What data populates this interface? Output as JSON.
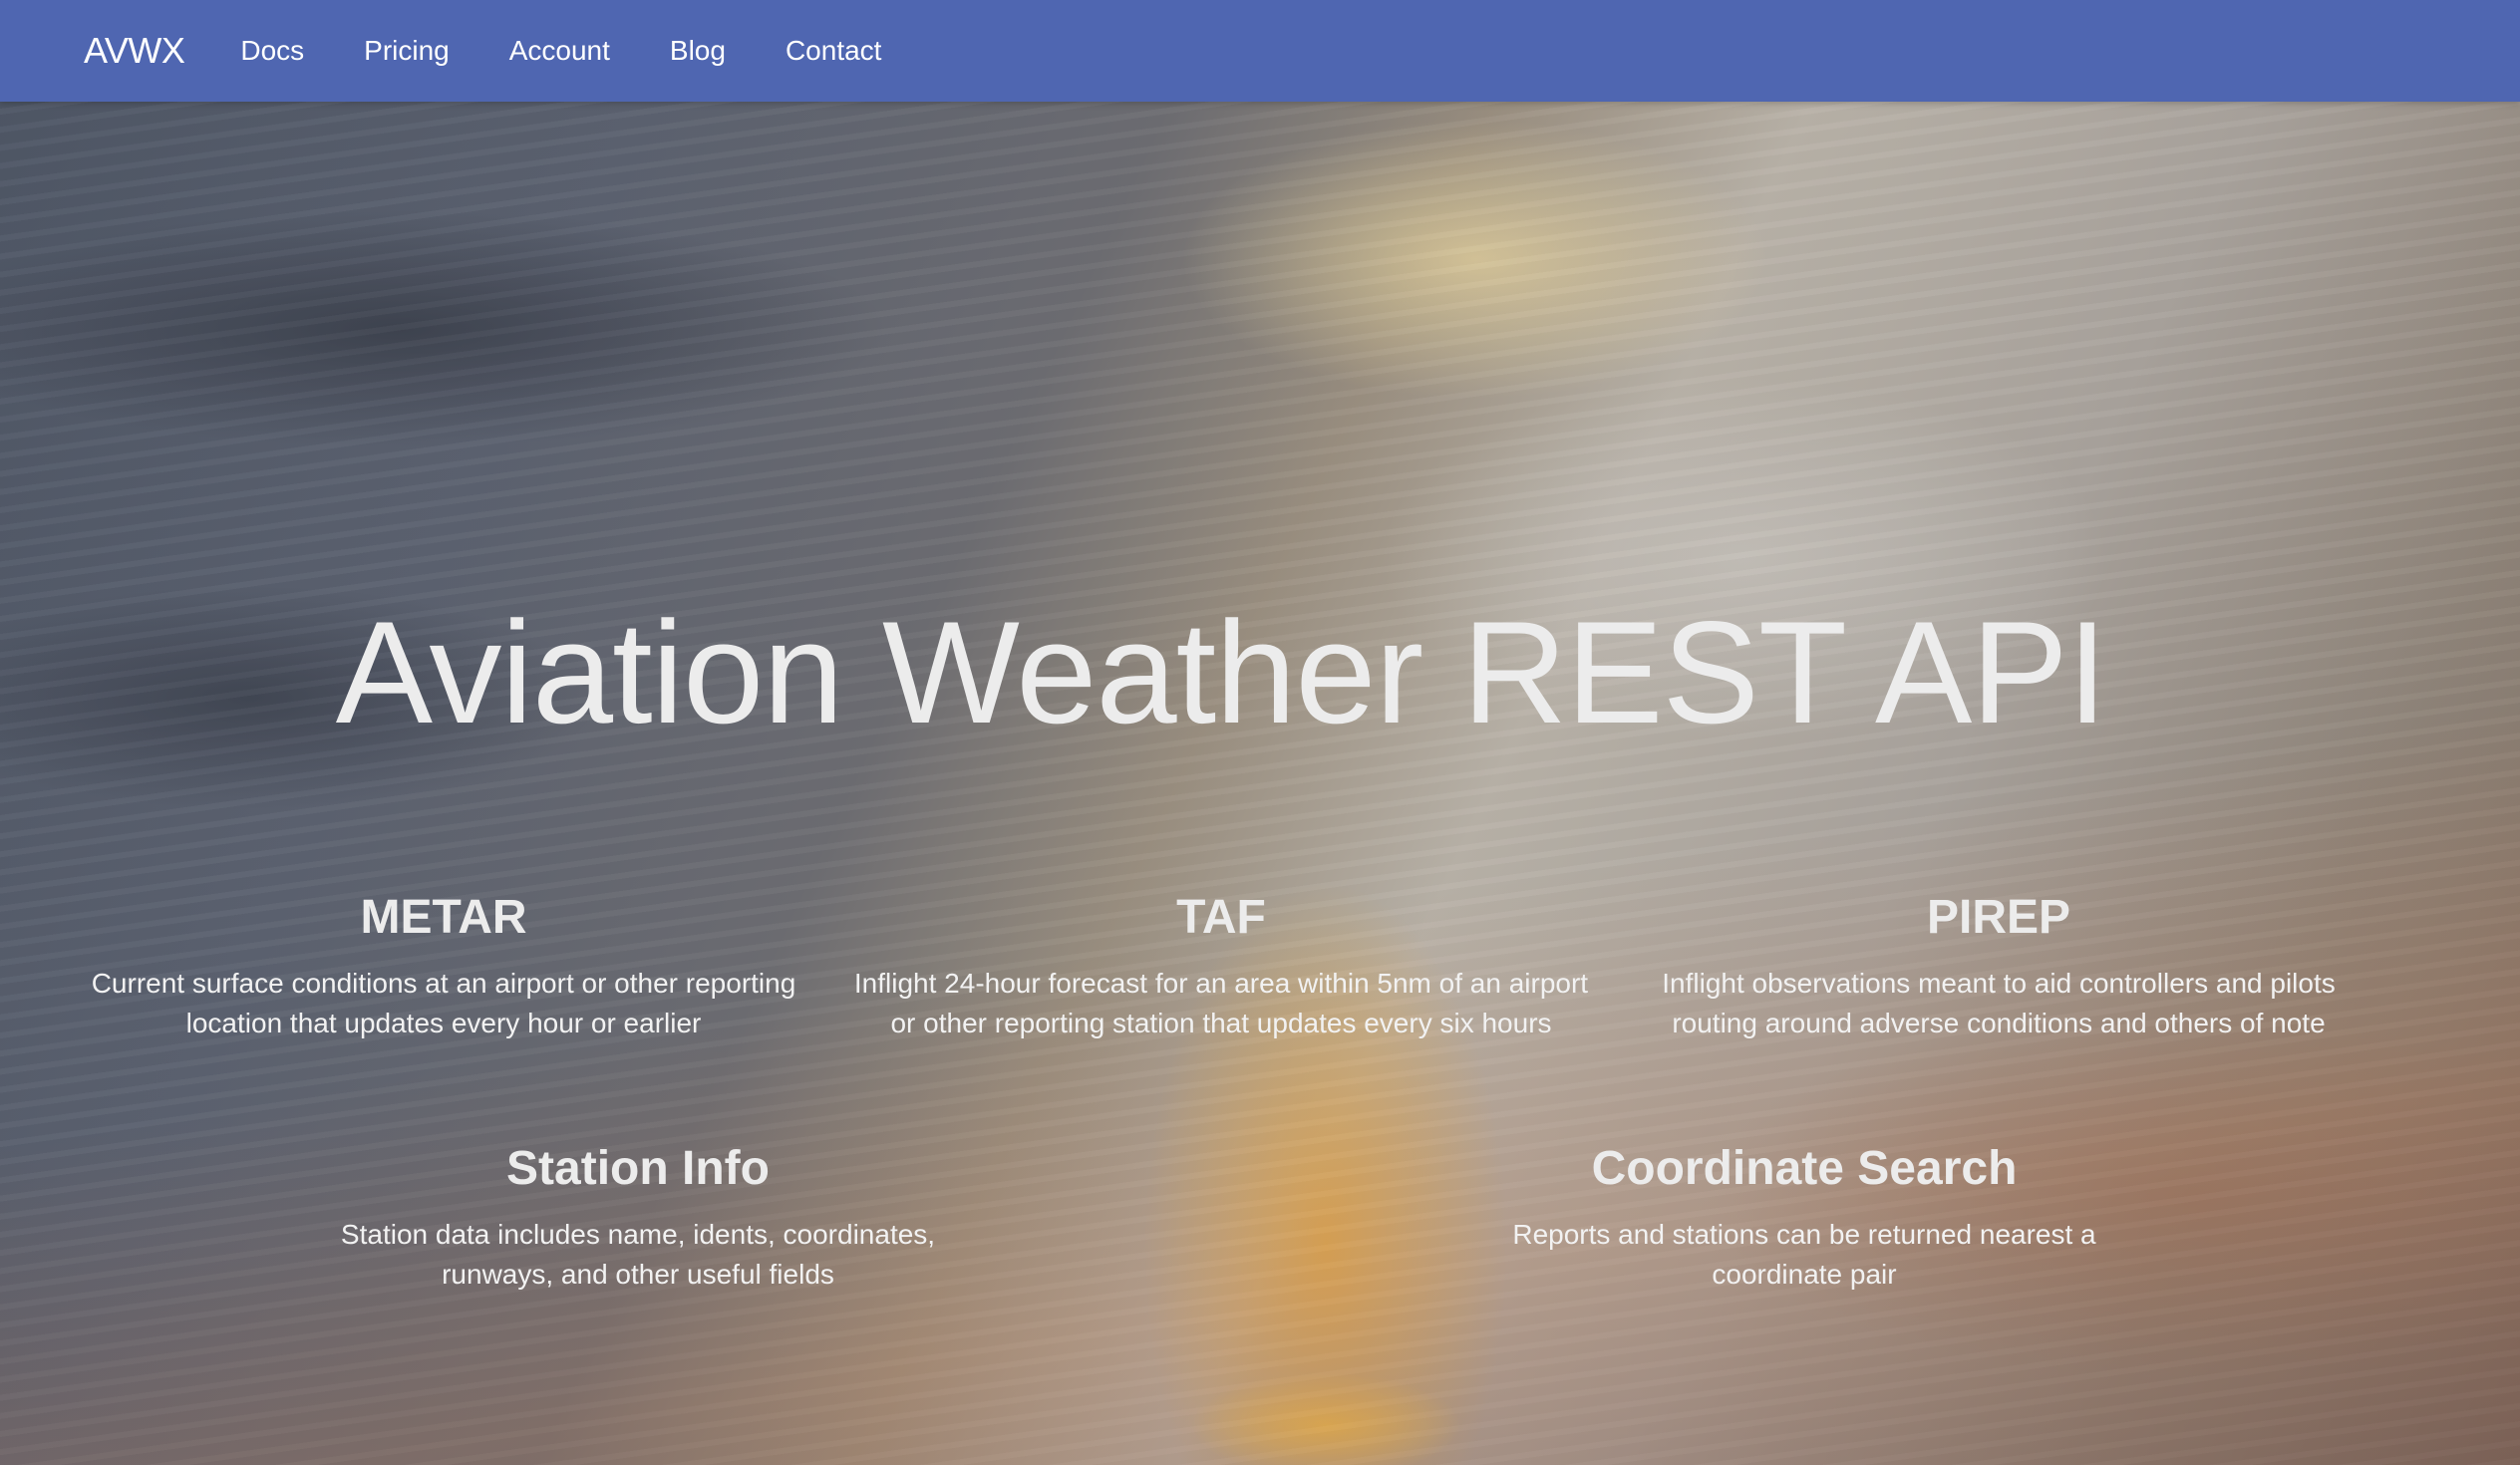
{
  "navbar": {
    "brand": "AVWX",
    "links": [
      "Docs",
      "Pricing",
      "Account",
      "Blog",
      "Contact"
    ]
  },
  "hero": {
    "title": "Aviation Weather REST API"
  },
  "features": {
    "metar": {
      "title": "METAR",
      "description": "Current surface conditions at an airport or other reporting location that updates every hour or earlier"
    },
    "taf": {
      "title": "TAF",
      "description": "Inflight 24-hour forecast for an area within 5nm of an airport or other reporting station that updates every six hours"
    },
    "pirep": {
      "title": "PIREP",
      "description": "Inflight observations meant to aid controllers and pilots routing around adverse conditions and others of note"
    },
    "station_info": {
      "title": "Station Info",
      "description": "Station data includes name, idents, coordinates, runways, and other useful fields"
    },
    "coordinate_search": {
      "title": "Coordinate Search",
      "description": "Reports and stations can be returned nearest a coordinate pair"
    }
  },
  "colors": {
    "navbar_bg": "#4f66b1",
    "text": "#ececec"
  }
}
